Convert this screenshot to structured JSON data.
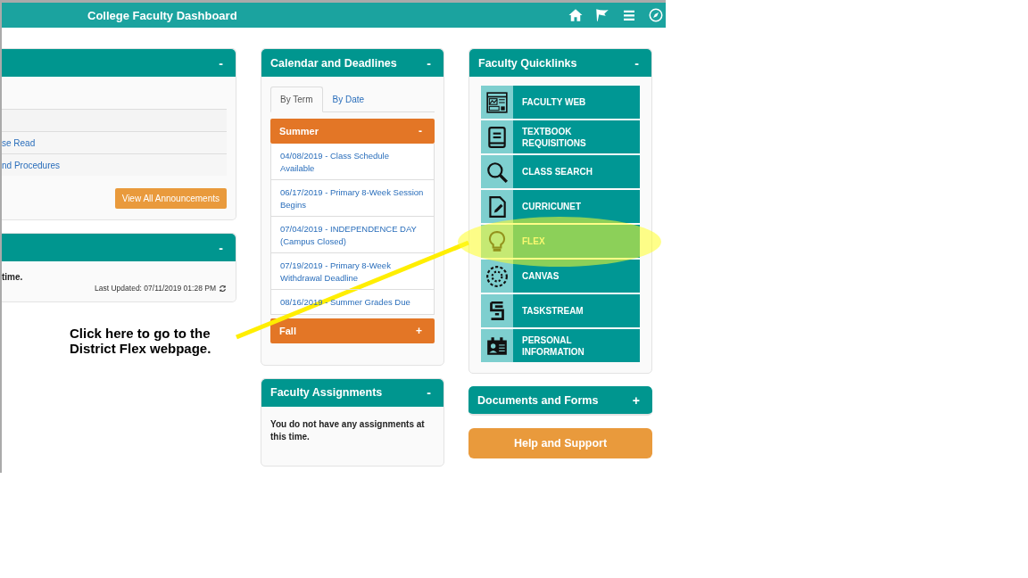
{
  "header": {
    "title": "College Faculty Dashboard"
  },
  "left_panels": [
    {
      "kind": "announcements",
      "toggle": "-",
      "rows": [
        "se Read",
        "nd Procedures"
      ],
      "button": "View All Announcements"
    },
    {
      "kind": "message",
      "toggle": "-",
      "message": "time.",
      "last_updated": "Last Updated: 07/11/2019 01:28 PM"
    }
  ],
  "calendar": {
    "title": "Calendar and Deadlines",
    "toggle": "-",
    "tabs": [
      {
        "label": "By Term",
        "selected": true
      },
      {
        "label": "By Date",
        "selected": false
      }
    ],
    "terms": [
      {
        "name": "Summer",
        "toggle": "-",
        "expanded": true,
        "events": [
          "04/08/2019 - Class Schedule Available",
          "06/17/2019 - Primary 8-Week Session Begins",
          "07/04/2019 - INDEPENDENCE DAY (Campus Closed)",
          "07/19/2019 - Primary 8-Week Withdrawal Deadline",
          "08/16/2019 - Summer Grades Due"
        ]
      },
      {
        "name": "Fall",
        "toggle": "+",
        "expanded": false
      }
    ]
  },
  "assignments": {
    "title": "Faculty Assignments",
    "toggle": "-",
    "message": "You do not have any assignments at this time."
  },
  "quicklinks": {
    "title": "Faculty Quicklinks",
    "toggle": "-",
    "links": [
      {
        "label": "FACULTY WEB",
        "highlighted": false
      },
      {
        "label": "TEXTBOOK REQUISITIONS",
        "highlighted": false
      },
      {
        "label": "CLASS SEARCH",
        "highlighted": false
      },
      {
        "label": "CURRICUNET",
        "highlighted": false
      },
      {
        "label": "FLEX",
        "highlighted": true
      },
      {
        "label": "CANVAS",
        "highlighted": false
      },
      {
        "label": "TASKSTREAM",
        "highlighted": false
      },
      {
        "label": "PERSONAL INFORMATION",
        "highlighted": false
      }
    ]
  },
  "documents": {
    "title": "Documents and Forms",
    "toggle": "+"
  },
  "help_button": "Help and Support",
  "annotation": {
    "text": "Click here to go to the District Flex webpage."
  }
}
